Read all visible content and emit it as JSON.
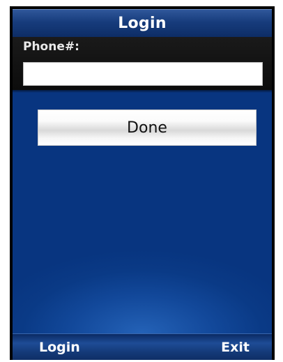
{
  "header": {
    "title": "Login"
  },
  "form": {
    "phone_label": "Phone#:",
    "phone_value": ""
  },
  "actions": {
    "done_label": "Done"
  },
  "softkeys": {
    "left_label": "Login",
    "right_label": "Exit"
  },
  "colors": {
    "title_bar": "#173c7c",
    "content_background": "#0a3a86",
    "content_glow": "#2462b7",
    "panel_background": "#111111",
    "button_face": "#f6f6f6",
    "text_light": "#ffffff"
  }
}
